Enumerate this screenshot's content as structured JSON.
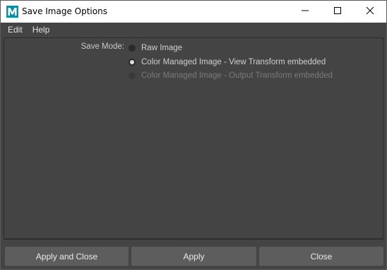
{
  "window": {
    "title": "Save Image Options",
    "app_icon": "maya-m-icon",
    "controls": {
      "minimize": "minimize-icon",
      "maximize": "maximize-icon",
      "close": "close-icon"
    }
  },
  "menubar": {
    "items": [
      {
        "label": "Edit"
      },
      {
        "label": "Help"
      }
    ]
  },
  "save_mode": {
    "label": "Save Mode:",
    "options": [
      {
        "label": "Raw Image",
        "selected": false,
        "enabled": true
      },
      {
        "label": "Color Managed Image - View Transform embedded",
        "selected": true,
        "enabled": true
      },
      {
        "label": "Color Managed Image - Output Transform embedded",
        "selected": false,
        "enabled": false
      }
    ]
  },
  "buttons": {
    "apply_and_close": "Apply and Close",
    "apply": "Apply",
    "close": "Close"
  },
  "colors": {
    "background": "#444444",
    "button": "#5d5d5d",
    "titlebar": "#ffffff",
    "app_icon_teal": "#0b8fa0"
  }
}
